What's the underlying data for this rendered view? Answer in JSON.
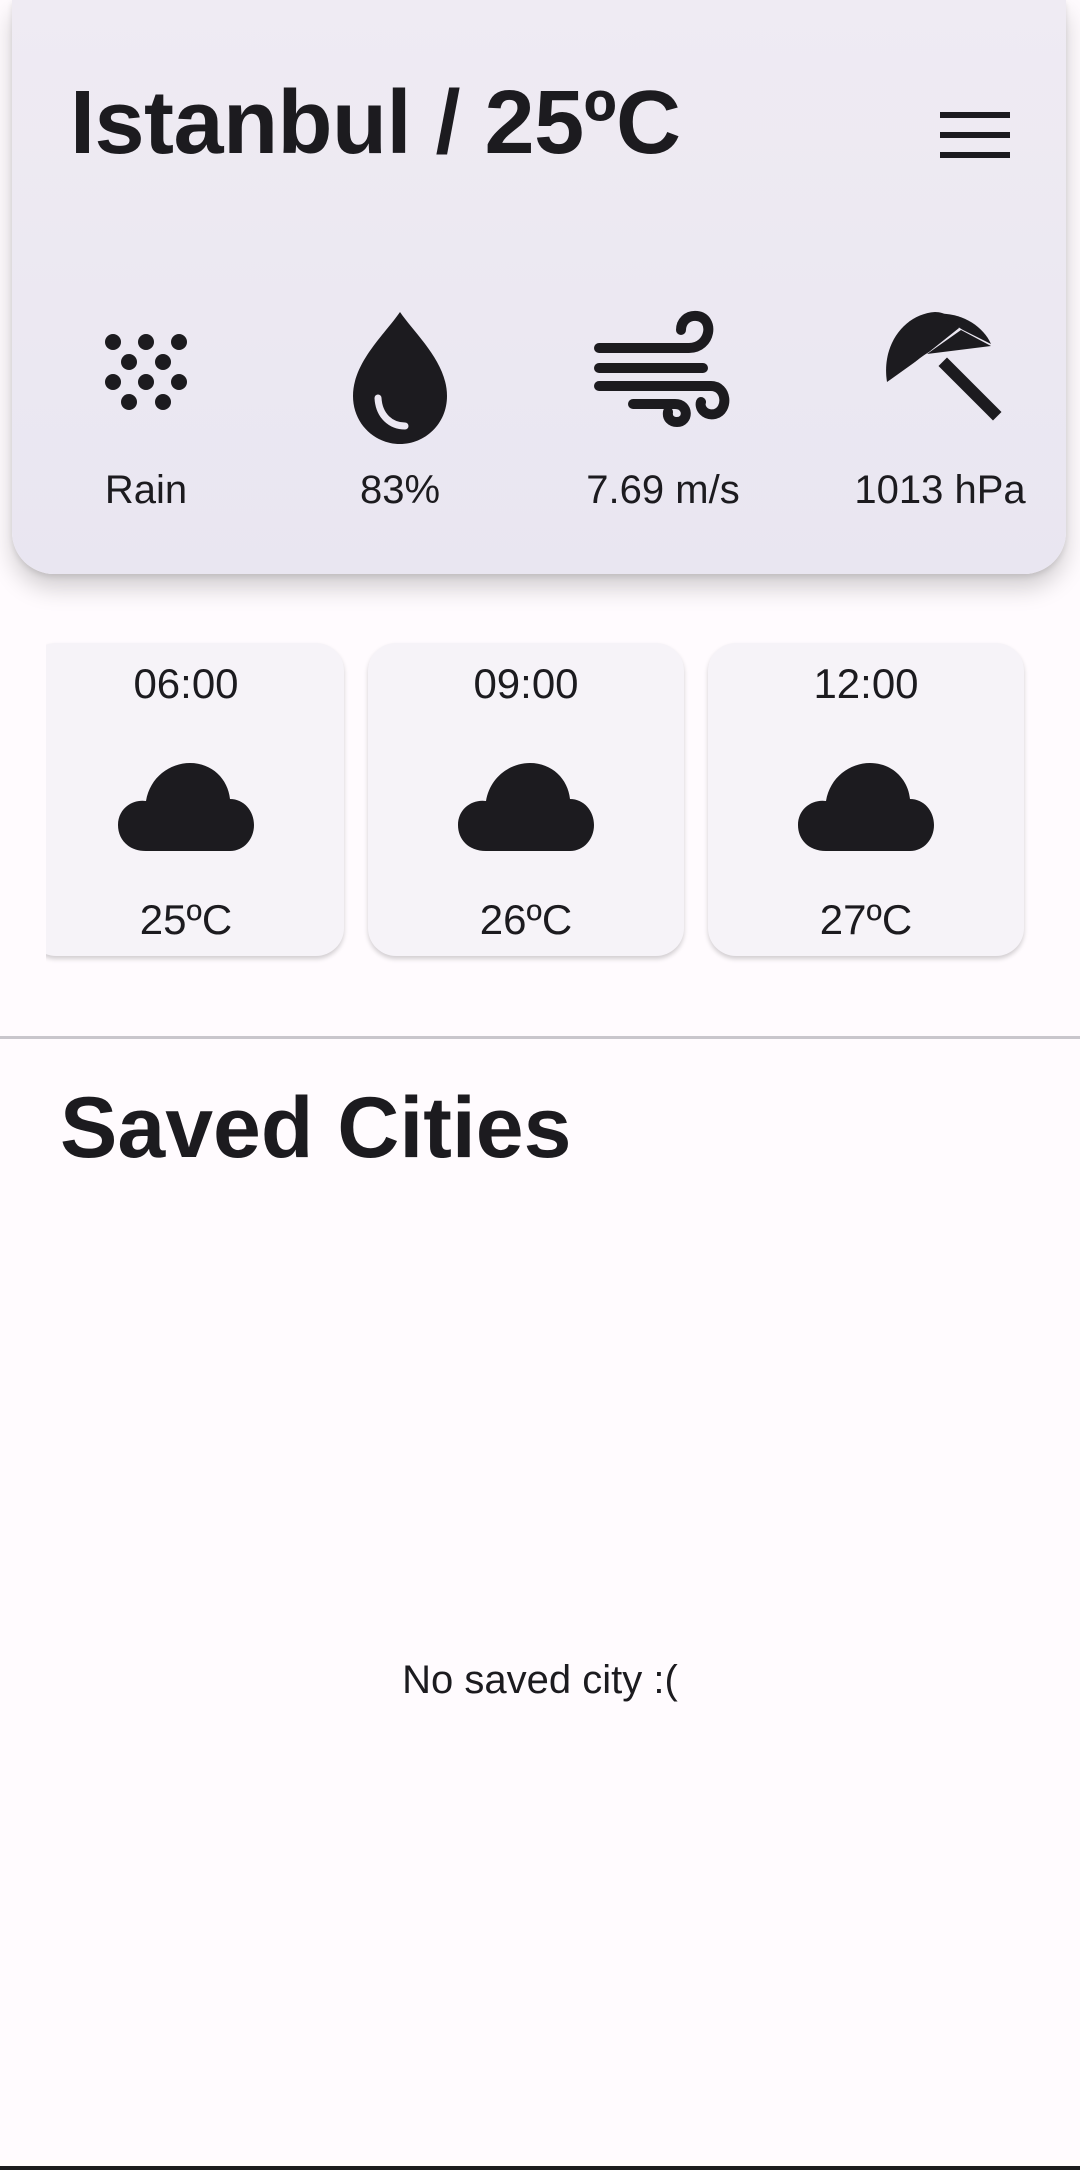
{
  "header": {
    "title": "Istanbul / 25ºC",
    "menu_icon": "menu-icon"
  },
  "stats": [
    {
      "icon": "rain-dots-icon",
      "label": "Rain"
    },
    {
      "icon": "water-drop-icon",
      "label": "83%"
    },
    {
      "icon": "wind-icon",
      "label": "7.69 m/s"
    },
    {
      "icon": "umbrella-icon",
      "label": "1013 hPa"
    }
  ],
  "hourly": [
    {
      "time": "06:00",
      "icon": "cloud-icon",
      "temp": "25ºC"
    },
    {
      "time": "09:00",
      "icon": "cloud-icon",
      "temp": "26ºC"
    },
    {
      "time": "12:00",
      "icon": "cloud-icon",
      "temp": "27ºC"
    }
  ],
  "saved": {
    "title": "Saved Cities",
    "empty_text": "No saved city :("
  },
  "colors": {
    "header_bg": "#ece8f2",
    "card_bg": "#f6f3f8",
    "text": "#1c1b1f",
    "page_bg": "#fffbfe"
  }
}
